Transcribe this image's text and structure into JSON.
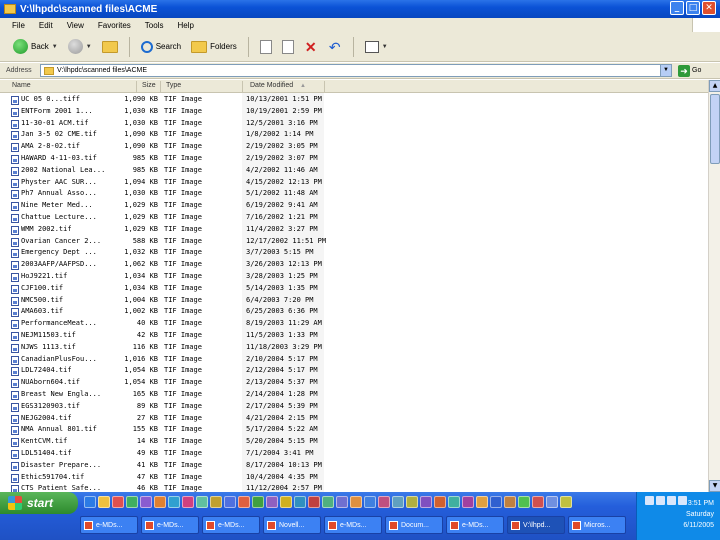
{
  "window": {
    "title": "V:\\lhpdc\\scanned files\\ACME",
    "minimize": "_",
    "maximize": "□",
    "close": "✕"
  },
  "menu": [
    "File",
    "Edit",
    "View",
    "Favorites",
    "Tools",
    "Help"
  ],
  "toolbar": {
    "back": "Back",
    "search": "Search",
    "folders": "Folders"
  },
  "address": {
    "label": "Address",
    "path": "V:\\lhpdc\\scanned files\\ACME",
    "go": "Go"
  },
  "columns": {
    "name": "Name",
    "size": "Size",
    "type": "Type",
    "date": "Date Modified"
  },
  "files": [
    {
      "name": "UC 05 0...tiff",
      "size": "1,090 KB",
      "type": "TIF Image",
      "date": "10/13/2001 1:51 PM"
    },
    {
      "name": "ENTForm 2001 1...",
      "size": "1,030 KB",
      "type": "TIF Image",
      "date": "10/19/2001 2:59 PM"
    },
    {
      "name": "11-30-01 ACM.tif",
      "size": "1,030 KB",
      "type": "TIF Image",
      "date": "12/5/2001 3:16 PM"
    },
    {
      "name": "Jan 3-5 02 CME.tif",
      "size": "1,090 KB",
      "type": "TIF Image",
      "date": "1/8/2002 1:14 PM"
    },
    {
      "name": "AMA 2-8-02.tif",
      "size": "1,090 KB",
      "type": "TIF Image",
      "date": "2/19/2002 3:05 PM"
    },
    {
      "name": "HAWARD 4-11-03.tif",
      "size": "985 KB",
      "type": "TIF Image",
      "date": "2/19/2002 3:07 PM"
    },
    {
      "name": "2002 National Lea...",
      "size": "985 KB",
      "type": "TIF Image",
      "date": "4/2/2002 11:46 AM"
    },
    {
      "name": "Physter AAC SUR...",
      "size": "1,094 KB",
      "type": "TIF Image",
      "date": "4/15/2002 12:13 PM"
    },
    {
      "name": "Ph7 Annual Asso...",
      "size": "1,030 KB",
      "type": "TIF Image",
      "date": "5/1/2002 11:48 AM"
    },
    {
      "name": "Nine Meter Med...",
      "size": "1,029 KB",
      "type": "TIF Image",
      "date": "6/19/2002 9:41 AM"
    },
    {
      "name": "Chattue Lecture...",
      "size": "1,029 KB",
      "type": "TIF Image",
      "date": "7/16/2002 1:21 PM"
    },
    {
      "name": "WMM 2002.tif",
      "size": "1,029 KB",
      "type": "TIF Image",
      "date": "11/4/2002 3:27 PM"
    },
    {
      "name": "Ovarian Cancer 2...",
      "size": "588 KB",
      "type": "TIF Image",
      "date": "12/17/2002 11:51 PM"
    },
    {
      "name": "Emergency Dept ...",
      "size": "1,032 KB",
      "type": "TIF Image",
      "date": "3/7/2003 5:15 PM"
    },
    {
      "name": "2003AAFP/AAFPSD...",
      "size": "1,062 KB",
      "type": "TIF Image",
      "date": "3/26/2003 12:13 PM"
    },
    {
      "name": "HoJ9221.tif",
      "size": "1,034 KB",
      "type": "TIF Image",
      "date": "3/28/2003 1:25 PM"
    },
    {
      "name": "CJF100.tif",
      "size": "1,034 KB",
      "type": "TIF Image",
      "date": "5/14/2003 1:35 PM"
    },
    {
      "name": "NMC500.tif",
      "size": "1,004 KB",
      "type": "TIF Image",
      "date": "6/4/2003 7:20 PM"
    },
    {
      "name": "AMA603.tif",
      "size": "1,002 KB",
      "type": "TIF Image",
      "date": "6/25/2003 6:36 PM"
    },
    {
      "name": "PerformanceMeat...",
      "size": "40 KB",
      "type": "TIF Image",
      "date": "8/19/2003 11:29 AM"
    },
    {
      "name": "NEJM11503.tif",
      "size": "42 KB",
      "type": "TIF Image",
      "date": "11/5/2003 1:33 PM"
    },
    {
      "name": "NJWS 1113.tif",
      "size": "116 KB",
      "type": "TIF Image",
      "date": "11/18/2003 3:29 PM"
    },
    {
      "name": "CanadianPlusFou...",
      "size": "1,016 KB",
      "type": "TIF Image",
      "date": "2/10/2004 5:17 PM"
    },
    {
      "name": "LDL72404.tif",
      "size": "1,054 KB",
      "type": "TIF Image",
      "date": "2/12/2004 5:17 PM"
    },
    {
      "name": "NUAborn604.tif",
      "size": "1,054 KB",
      "type": "TIF Image",
      "date": "2/13/2004 5:37 PM"
    },
    {
      "name": "Breast New Engla...",
      "size": "165 KB",
      "type": "TIF Image",
      "date": "2/14/2004 1:28 PM"
    },
    {
      "name": "EGS3120903.tif",
      "size": "89 KB",
      "type": "TIF Image",
      "date": "2/17/2004 5:39 PM"
    },
    {
      "name": "NEJG2004.tif",
      "size": "27 KB",
      "type": "TIF Image",
      "date": "4/21/2004 2:15 PM"
    },
    {
      "name": "NMA Annual 801.tif",
      "size": "155 KB",
      "type": "TIF Image",
      "date": "5/17/2004 5:22 AM"
    },
    {
      "name": "KentCVM.tif",
      "size": "14 KB",
      "type": "TIF Image",
      "date": "5/20/2004 5:15 PM"
    },
    {
      "name": "LDL51404.tif",
      "size": "49 KB",
      "type": "TIF Image",
      "date": "7/1/2004 3:41 PM"
    },
    {
      "name": "Disaster Prepare...",
      "size": "41 KB",
      "type": "TIF Image",
      "date": "8/17/2004 10:13 PM"
    },
    {
      "name": "Ethic591704.tif",
      "size": "47 KB",
      "type": "TIF Image",
      "date": "10/4/2004 4:35 PM"
    },
    {
      "name": "CTS Patient Safe...",
      "size": "46 KB",
      "type": "TIF Image",
      "date": "11/12/2004 2:57 PM"
    }
  ],
  "taskbar": {
    "start": "start",
    "tasks": [
      "e-MDs...",
      "e-MDs...",
      "e-MDs...",
      "Novell...",
      "e-MDs...",
      "Docum...",
      "e-MDs...",
      "V:\\lhpd...",
      "Micros..."
    ],
    "clock_time": "3:51 PM",
    "clock_day": "Saturday",
    "clock_date": "6/11/2005"
  },
  "colors": {
    "titlebar": "#0b52d6",
    "chrome": "#ece9d8",
    "taskbar": "#245edb",
    "start": "#2d8a2d"
  }
}
